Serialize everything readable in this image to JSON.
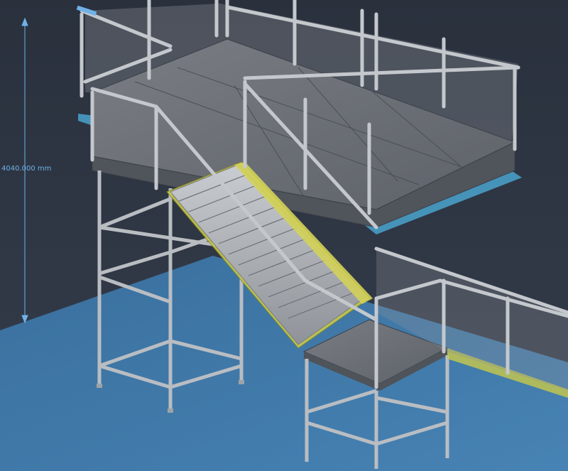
{
  "viewport": {
    "dimension_label": "4040.000 mm",
    "colors": {
      "background": "#2c3340",
      "floor_plane": "#3d7fb6",
      "deck": "#6e737a",
      "frame": "#b9bdc2",
      "stair_stringer": "#c9c94a",
      "dimension": "#6fb2e8"
    }
  }
}
